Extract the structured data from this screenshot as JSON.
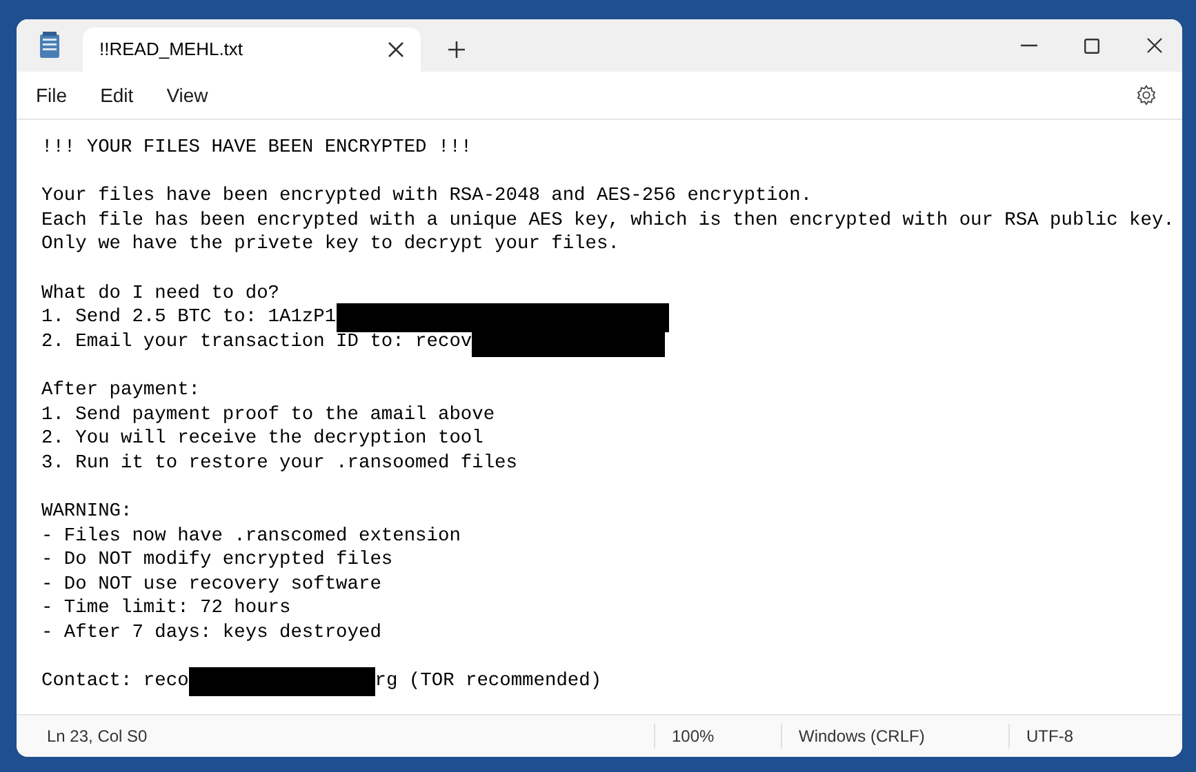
{
  "window": {
    "tab": {
      "title": "!!READ_MEHL.txt",
      "selected": true
    }
  },
  "menu": [
    "File",
    "Edit",
    "View"
  ],
  "document": {
    "paragraphs": [
      [
        {
          "parts": [
            {
              "kind": "text",
              "text": "!!! YOUR FILES HAVE BEEN ENCRYPTED !!!"
            }
          ]
        }
      ],
      [
        {
          "parts": [
            {
              "kind": "text",
              "text": "Your files have been encrypted with RSA-2048 and AES-256 encryption."
            }
          ]
        },
        {
          "parts": [
            {
              "kind": "text",
              "text": "Each file has been encrypted with a unique AES key, which is then encrypted with our RSA public key."
            }
          ]
        },
        {
          "parts": [
            {
              "kind": "text",
              "text": "Only we have the privete key to decrypt your files."
            }
          ]
        }
      ],
      [
        {
          "parts": [
            {
              "kind": "text",
              "text": "What do I need to do?"
            }
          ]
        },
        {
          "parts": [
            {
              "kind": "text",
              "text": "1. Send 2.5 BTC to: 1A1zP1"
            },
            {
              "kind": "redaction"
            }
          ]
        },
        {
          "parts": [
            {
              "kind": "text",
              "text": "2. Email your transaction ID to: recov"
            },
            {
              "kind": "redaction"
            }
          ]
        }
      ],
      [
        {
          "parts": [
            {
              "kind": "text",
              "text": "After payment:"
            }
          ]
        },
        {
          "parts": [
            {
              "kind": "text",
              "text": "1. Send payment proof to the amail above"
            }
          ]
        },
        {
          "parts": [
            {
              "kind": "text",
              "text": "2. You will receive the decryption tool"
            }
          ]
        },
        {
          "parts": [
            {
              "kind": "text",
              "text": "3. Run it to restore your .ransoomed files"
            }
          ]
        }
      ],
      [
        {
          "parts": [
            {
              "kind": "text",
              "text": "WARNING:"
            }
          ]
        },
        {
          "parts": [
            {
              "kind": "text",
              "text": "- Files now have .ranscomed extension"
            }
          ]
        },
        {
          "parts": [
            {
              "kind": "text",
              "text": "- Do NOT modify encrypted files"
            }
          ]
        },
        {
          "parts": [
            {
              "kind": "text",
              "text": "- Do NOT use recovery software"
            }
          ]
        },
        {
          "parts": [
            {
              "kind": "text",
              "text": "- Time limit: 72 hours"
            }
          ]
        },
        {
          "parts": [
            {
              "kind": "text",
              "text": "- After 7 days: keys destroyed"
            }
          ]
        }
      ],
      [
        {
          "parts": [
            {
              "kind": "text",
              "text": "Contact: reco"
            },
            {
              "kind": "redaction"
            },
            {
              "kind": "text",
              "text": "rg (TOR recommended)"
            }
          ]
        }
      ]
    ]
  },
  "status_bar": [
    "Ln 23, Col S0",
    "100%",
    "Windows (CRLF)",
    "UTF-8"
  ]
}
